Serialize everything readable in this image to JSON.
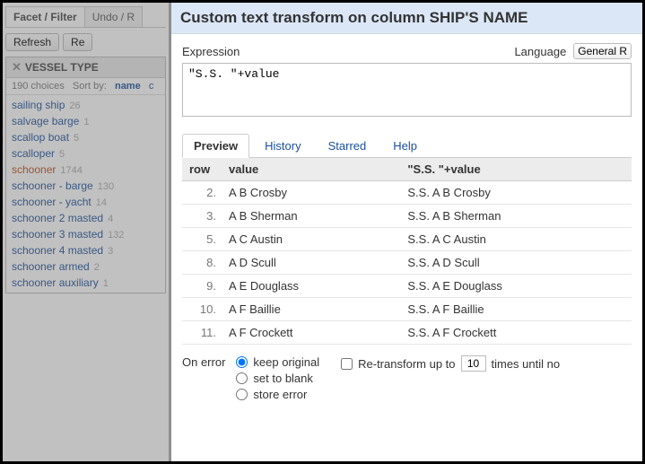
{
  "sidebar": {
    "tabs": {
      "facet": "Facet / Filter",
      "undo": "Undo / R"
    },
    "buttons": {
      "refresh": "Refresh",
      "re": "Re"
    },
    "facet": {
      "title": "VESSEL TYPE",
      "choices_text": "190 choices",
      "sort_label": "Sort by:",
      "sort_name": "name",
      "sort_c": "c",
      "items": [
        {
          "label": "sailing ship",
          "count": "26",
          "selected": false
        },
        {
          "label": "salvage barge",
          "count": "1",
          "selected": false
        },
        {
          "label": "scallop boat",
          "count": "5",
          "selected": false
        },
        {
          "label": "scalloper",
          "count": "5",
          "selected": false
        },
        {
          "label": "schooner",
          "count": "1744",
          "selected": true
        },
        {
          "label": "schooner - barge",
          "count": "130",
          "selected": false
        },
        {
          "label": "schooner - yacht",
          "count": "14",
          "selected": false
        },
        {
          "label": "schooner 2 masted",
          "count": "4",
          "selected": false
        },
        {
          "label": "schooner 3 masted",
          "count": "132",
          "selected": false
        },
        {
          "label": "schooner 4 masted",
          "count": "3",
          "selected": false
        },
        {
          "label": "schooner armed",
          "count": "2",
          "selected": false
        },
        {
          "label": "schooner auxiliary",
          "count": "1",
          "selected": false
        }
      ]
    }
  },
  "dialog": {
    "title": "Custom text transform on column SHIP'S NAME",
    "expression_label": "Expression",
    "language_label": "Language",
    "language_value": "General R",
    "expression_value": "\"S.S. \"+value",
    "tabs": {
      "preview": "Preview",
      "history": "History",
      "starred": "Starred",
      "help": "Help"
    },
    "preview": {
      "headers": {
        "row": "row",
        "value": "value",
        "result": "\"S.S. \"+value"
      },
      "rows": [
        {
          "n": "2.",
          "v": "A B Crosby",
          "r": "S.S. A B Crosby"
        },
        {
          "n": "3.",
          "v": "A B Sherman",
          "r": "S.S. A B Sherman"
        },
        {
          "n": "5.",
          "v": "A C Austin",
          "r": "S.S. A C Austin"
        },
        {
          "n": "8.",
          "v": "A D Scull",
          "r": "S.S. A D Scull"
        },
        {
          "n": "9.",
          "v": "A E Douglass",
          "r": "S.S. A E Douglass"
        },
        {
          "n": "10.",
          "v": "A F Baillie",
          "r": "S.S. A F Baillie"
        },
        {
          "n": "11.",
          "v": "A F Crockett",
          "r": "S.S. A F Crockett"
        }
      ]
    },
    "onerror": {
      "label": "On error",
      "keep": "keep original",
      "blank": "set to blank",
      "store": "store error",
      "selected": "keep"
    },
    "retransform": {
      "prefix": "Re-transform up to",
      "value": "10",
      "suffix": "times until no"
    }
  }
}
